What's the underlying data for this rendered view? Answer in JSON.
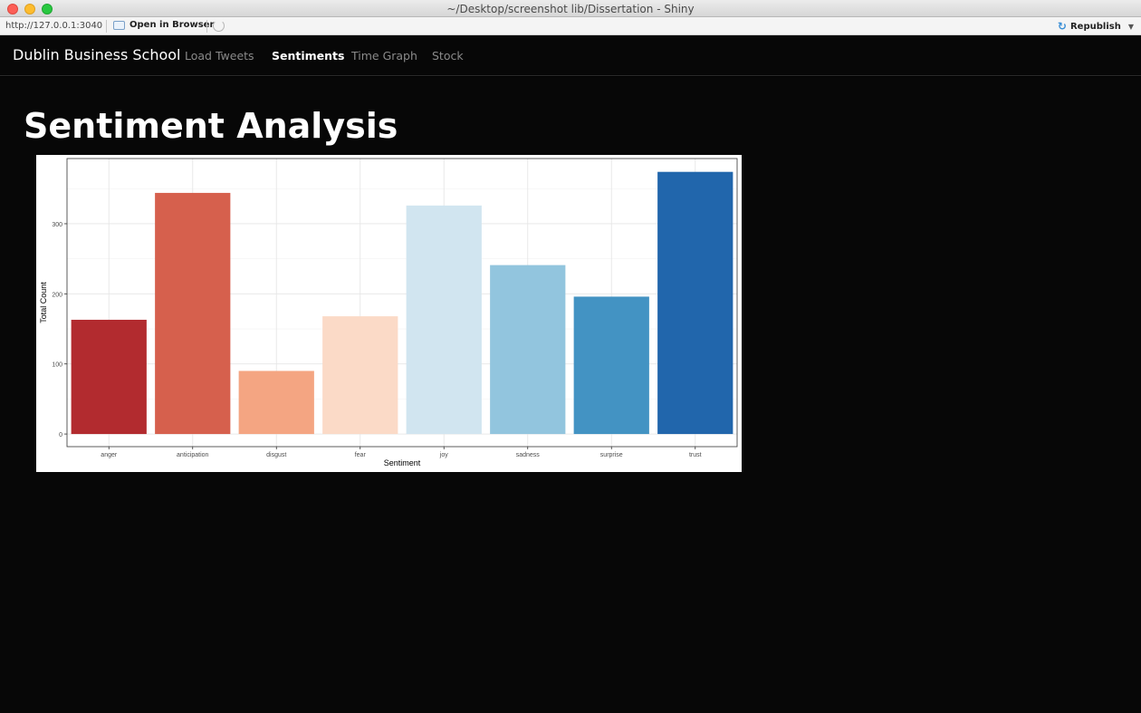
{
  "window": {
    "title": "~/Desktop/screenshot lib/Dissertation - Shiny"
  },
  "toolbar": {
    "url": "http://127.0.0.1:3040",
    "open_label": "Open in Browser",
    "republish_label": "Republish"
  },
  "navbar": {
    "brand": "Dublin Business School",
    "tabs": [
      {
        "label": "Load Tweets"
      },
      {
        "label": "Sentiments"
      },
      {
        "label": "Time Graph"
      },
      {
        "label": "Stock"
      }
    ]
  },
  "page": {
    "title": "Sentiment Analysis"
  },
  "chart_data": {
    "type": "bar",
    "categories": [
      "anger",
      "anticipation",
      "disgust",
      "fear",
      "joy",
      "sadness",
      "surprise",
      "trust"
    ],
    "values": [
      163,
      344,
      90,
      168,
      326,
      241,
      196,
      374
    ],
    "colors": [
      "#b22b2f",
      "#d6604d",
      "#f4a582",
      "#fbdac7",
      "#d1e5f0",
      "#92c5de",
      "#4393c3",
      "#2166ac"
    ],
    "xlabel": "Sentiment",
    "ylabel": "Total Count",
    "yticks": [
      0,
      100,
      200,
      300
    ],
    "ylim": [
      -18,
      393
    ],
    "grid": true
  }
}
